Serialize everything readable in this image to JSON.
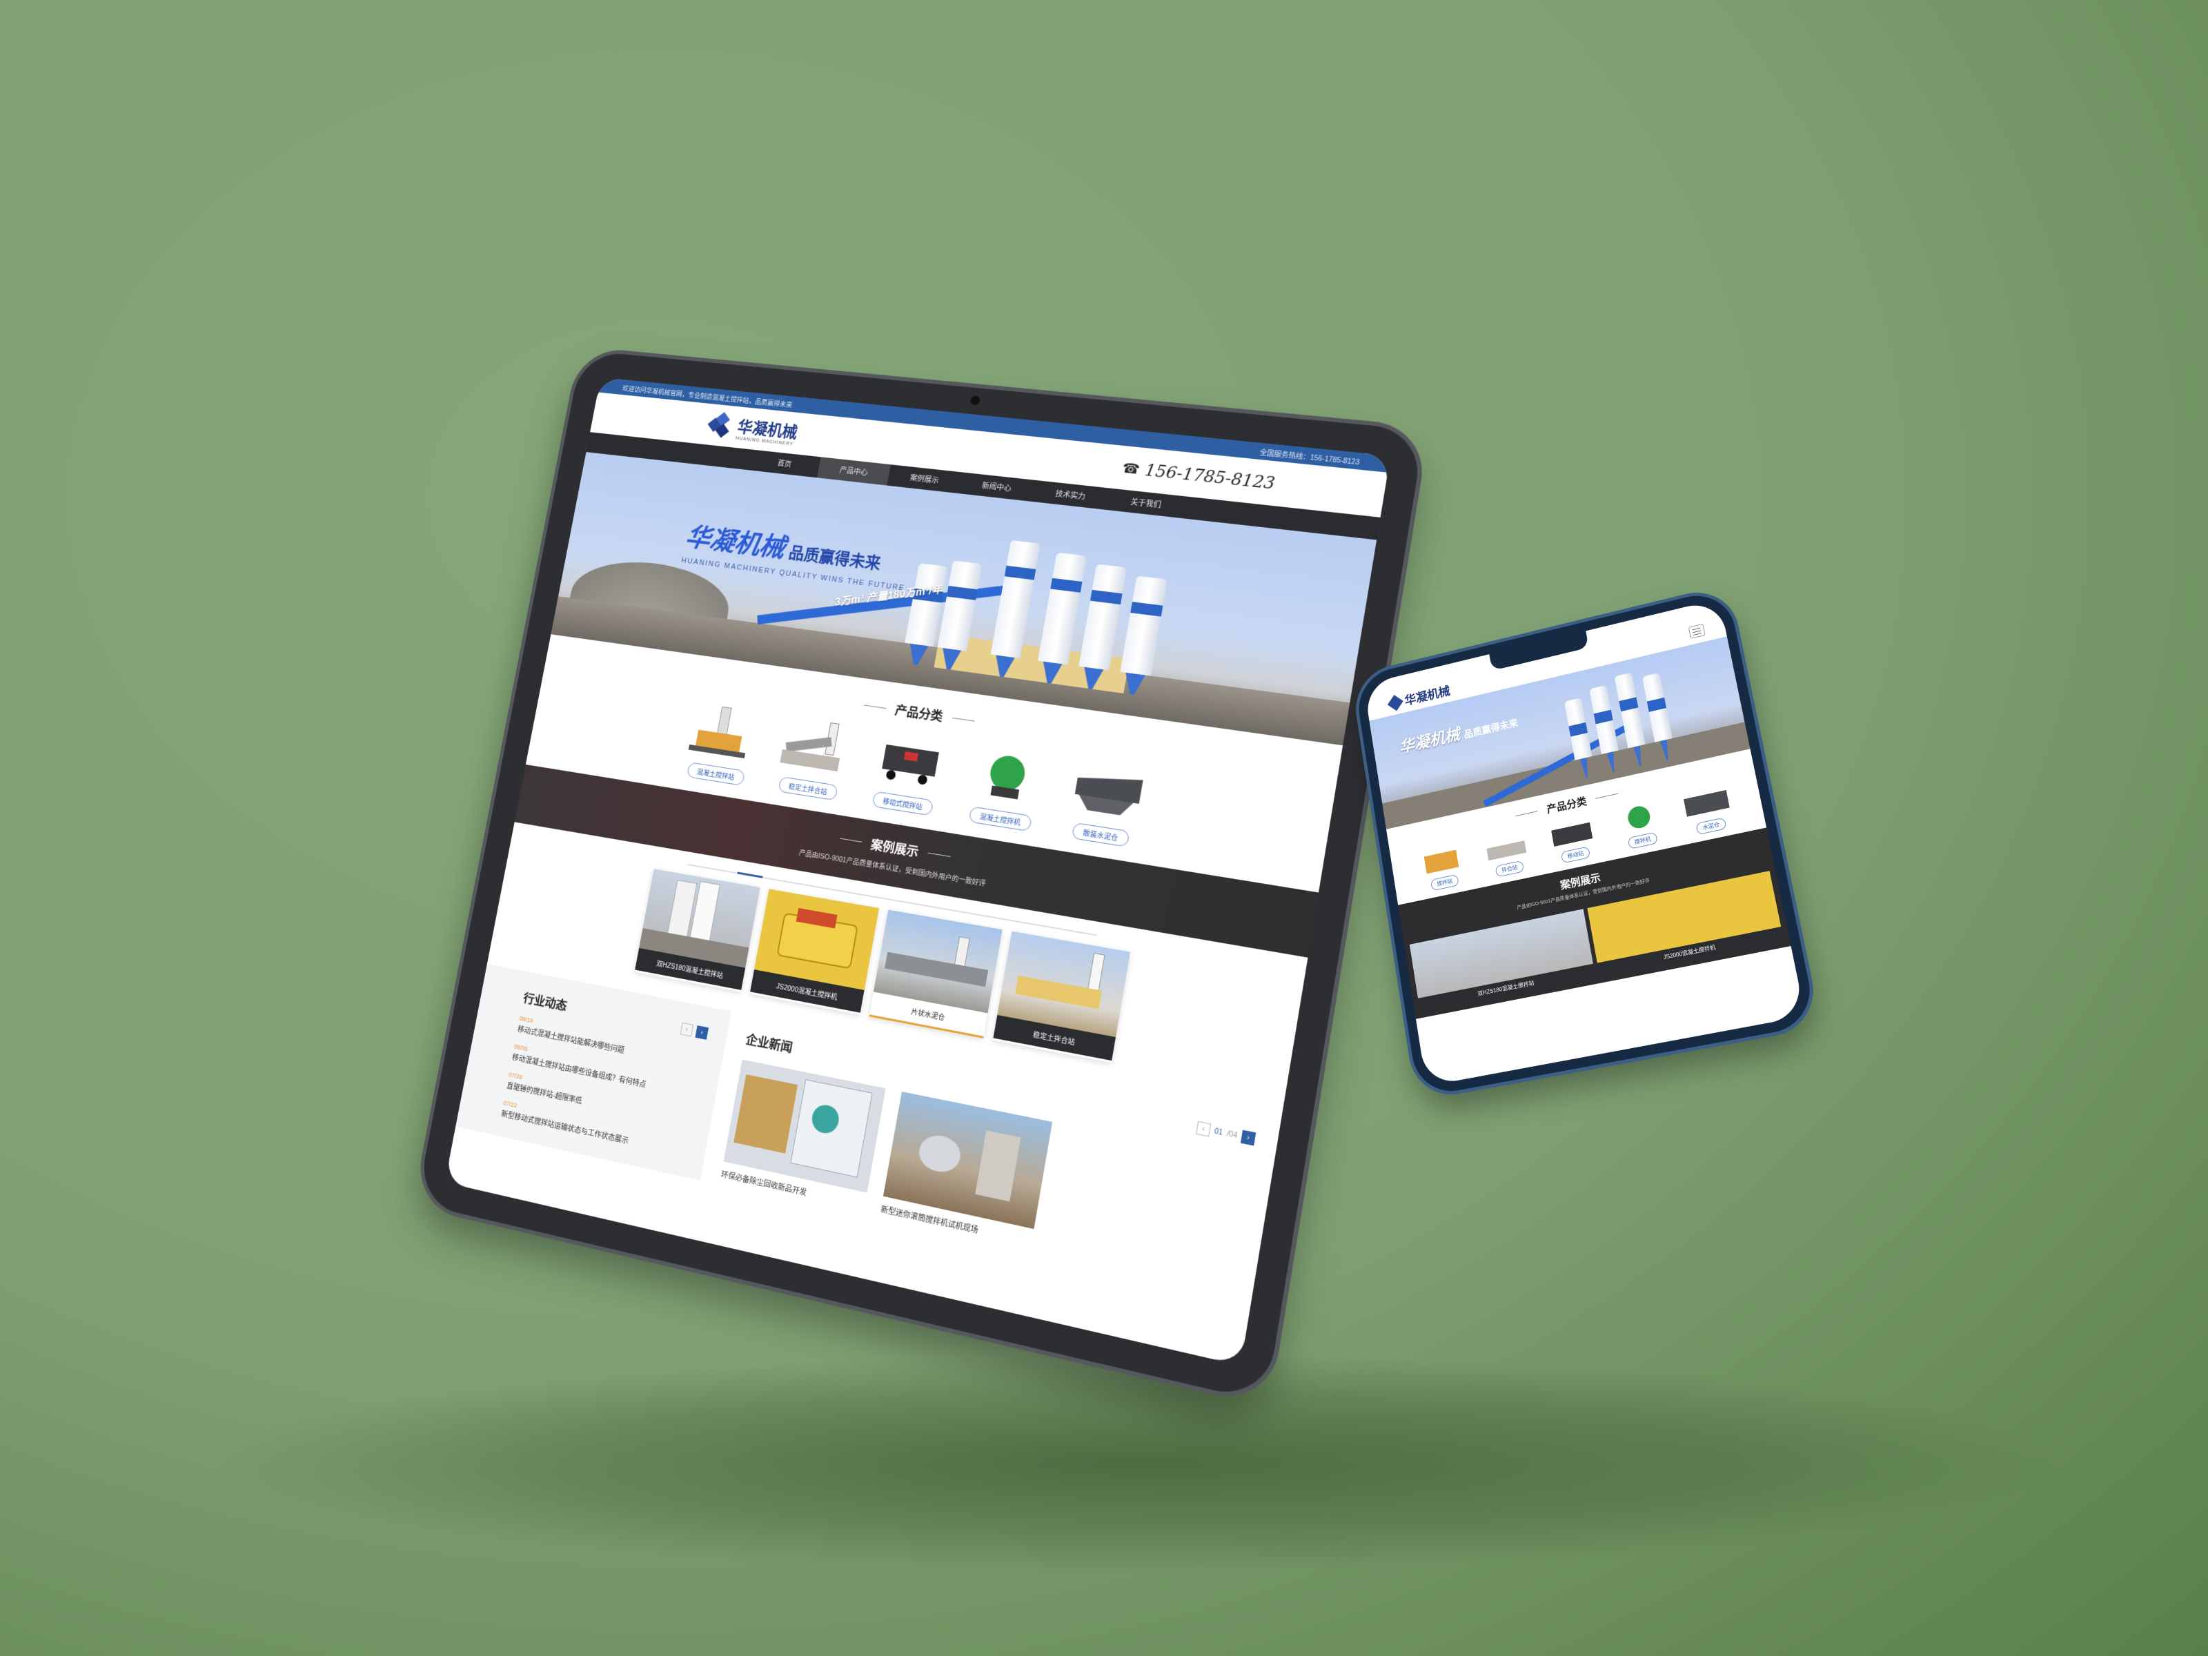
{
  "topbar": {
    "left": "欢迎访问华凝机械官网，专业制造混凝土搅拌站，品质赢得未来",
    "right": "全国服务热线：156-1785-8123"
  },
  "brand": {
    "name": "华凝机械",
    "sub": "HUANING MACHINERY",
    "phone": "156-1785-8123",
    "primary_color": "#2f5fa3",
    "dark_color": "#2b2c2f",
    "accent_color": "#e8a23a"
  },
  "nav": [
    {
      "label": "首页"
    },
    {
      "label": "产品中心"
    },
    {
      "label": "案例展示"
    },
    {
      "label": "新闻中心"
    },
    {
      "label": "技术实力"
    },
    {
      "label": "关于我们"
    }
  ],
  "banner": {
    "title": "华凝机械",
    "slogan": "品质赢得未来",
    "english": "HUANING MACHINERY QUALITY WINS THE FUTURE",
    "badge": "3万m³ 产量180万m³/年"
  },
  "products": {
    "title": "产品分类",
    "items": [
      {
        "label": "混凝土搅拌站",
        "icon": "batching-plant-icon"
      },
      {
        "label": "稳定土拌合站",
        "icon": "soil-mixing-plant-icon"
      },
      {
        "label": "移动式搅拌站",
        "icon": "mobile-plant-icon"
      },
      {
        "label": "混凝土搅拌机",
        "icon": "mixer-icon"
      },
      {
        "label": "散装水泥仓",
        "icon": "cement-silo-icon"
      }
    ]
  },
  "cases": {
    "title": "案例展示",
    "subtitle": "产品由ISO-9001产品质量体系认证，受到国内外用户的一致好评",
    "items": [
      {
        "label": "双HZS180混凝土搅拌站"
      },
      {
        "label": "JS2000混凝土搅拌机"
      },
      {
        "label": "片状水泥仓"
      },
      {
        "label": "稳定土拌合站"
      }
    ]
  },
  "industry_news": {
    "title": "行业动态",
    "items": [
      {
        "date": "08/10",
        "title": "移动式混凝土搅拌站能解决哪些问题"
      },
      {
        "date": "08/05",
        "title": "移动混凝土搅拌站由哪些设备组成？有何特点"
      },
      {
        "date": "07/28",
        "title": "直驱锤的搅拌站-超限率低"
      },
      {
        "date": "07/22",
        "title": "新型移动式搅拌站运输状态与工作状态展示"
      }
    ]
  },
  "company_news": {
    "title": "企业新闻",
    "page": "01",
    "total": "/04",
    "items": [
      {
        "title": "环保必备除尘回收新品开发"
      },
      {
        "title": "新型迷你滚筒搅拌机试机现场"
      }
    ]
  },
  "mobile": {
    "products": [
      {
        "label": "搅拌站"
      },
      {
        "label": "拌合站"
      },
      {
        "label": "移动站"
      },
      {
        "label": "搅拌机"
      },
      {
        "label": "水泥仓"
      }
    ],
    "cases": [
      {
        "label": "双HZS180混凝土搅拌站"
      },
      {
        "label": "JS2000混凝土搅拌机"
      }
    ]
  }
}
